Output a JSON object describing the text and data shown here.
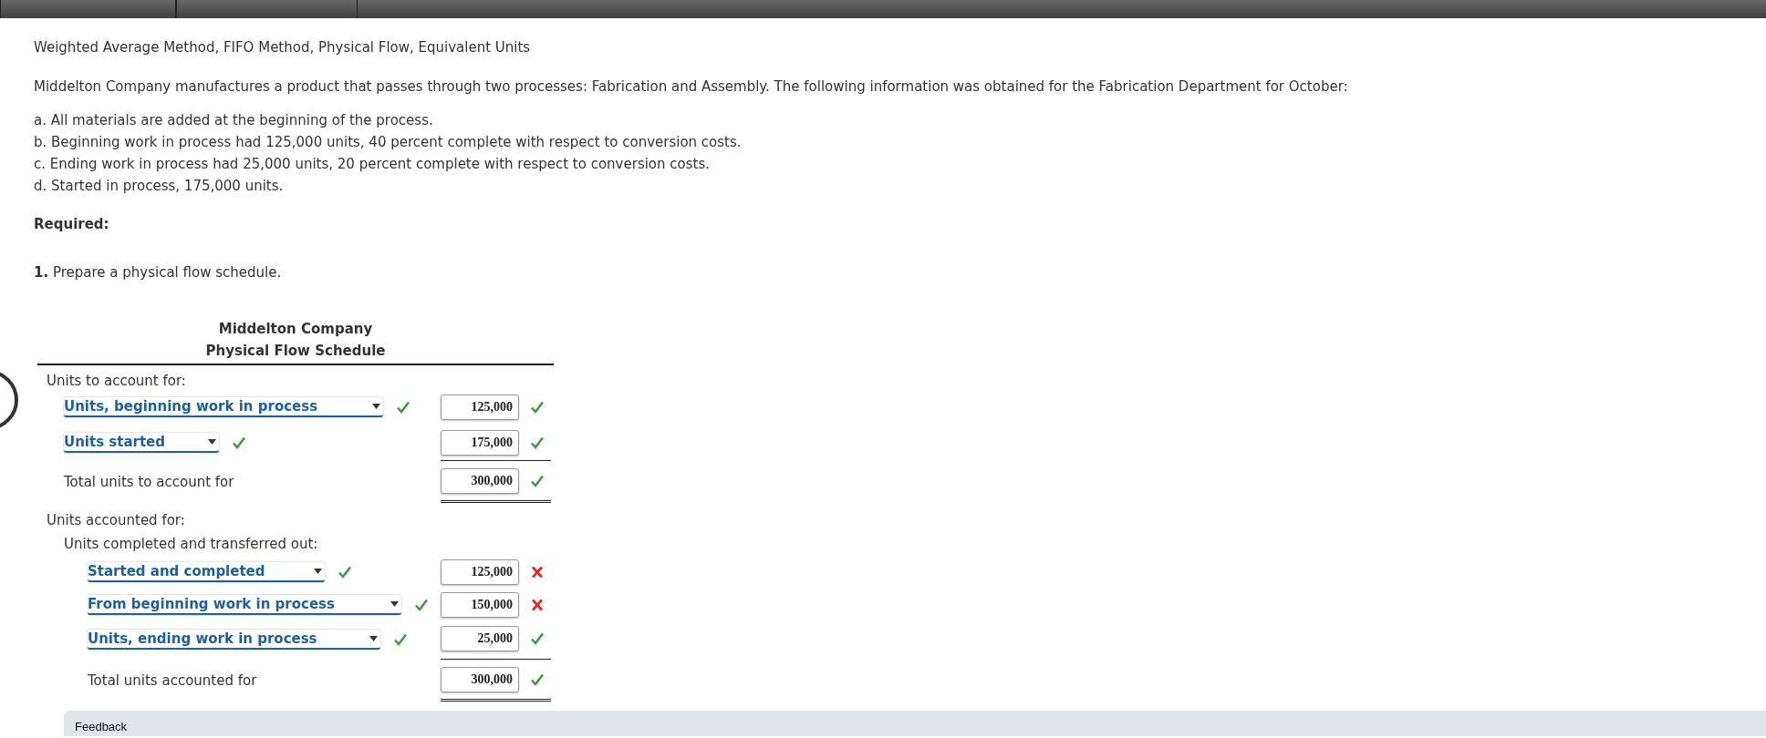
{
  "title": "Weighted Average Method, FIFO Method, Physical Flow, Equivalent Units",
  "intro": "Middelton Company manufactures a product that passes through two processes: Fabrication and Assembly. The following information was obtained for the Fabrication Department for October:",
  "conditions": [
    "a. All materials are added at the beginning of the process.",
    "b. Beginning work in process had 125,000 units, 40 percent complete with respect to conversion costs.",
    "c. Ending work in process had 25,000 units, 20 percent complete with respect to conversion costs.",
    "d. Started in process, 175,000 units."
  ],
  "required_label": "Required:",
  "task": "**1.** Prepare a physical flow schedule.",
  "schedule": {
    "company": "Middelton Company",
    "title": "Physical Flow Schedule",
    "sections": [
      {
        "label": "Units to account for:",
        "rows": [
          {
            "kind": "dropdown",
            "label": "Units, beginning work in process",
            "label_correct": true,
            "value": "125,000",
            "value_correct": true
          },
          {
            "kind": "dropdown",
            "label": "Units started",
            "label_correct": true,
            "value": "175,000",
            "value_correct": true
          },
          {
            "kind": "total",
            "label": "Total units to account for",
            "value": "300,000",
            "value_correct": true
          }
        ]
      },
      {
        "label": "Units accounted for:",
        "sublabel": "Units completed and transferred out:",
        "rows": [
          {
            "kind": "dropdown",
            "label": "Started and completed",
            "label_correct": true,
            "value": "125,000",
            "value_correct": false
          },
          {
            "kind": "dropdown",
            "label": "From beginning work in process",
            "label_correct": true,
            "value": "150,000",
            "value_correct": false
          },
          {
            "kind": "dropdown",
            "label": "Units, ending work in process",
            "label_correct": true,
            "value": "25,000",
            "value_correct": true
          },
          {
            "kind": "total",
            "label": "Total units accounted for",
            "value": "300,000",
            "value_correct": true
          }
        ]
      }
    ]
  },
  "feedback": {
    "label": "Feedback"
  }
}
